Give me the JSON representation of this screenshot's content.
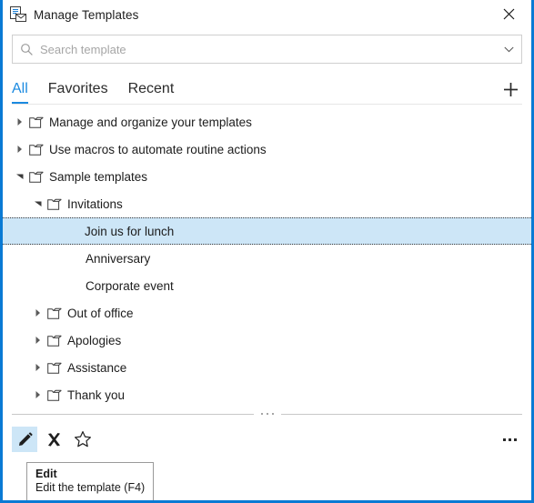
{
  "window": {
    "title": "Manage Templates",
    "title_icon": "template-envelope-icon",
    "close_icon": "close-icon",
    "accent_color": "#0a7ad4"
  },
  "search": {
    "placeholder": "Search template",
    "value": "",
    "icon": "search-icon",
    "dropdown_icon": "chevron-down-icon"
  },
  "tabs": {
    "items": [
      {
        "label": "All",
        "active": true
      },
      {
        "label": "Favorites",
        "active": false
      },
      {
        "label": "Recent",
        "active": false
      }
    ],
    "add_icon": "plus-icon",
    "active_color": "#1b8ae0"
  },
  "tree": {
    "nodes": [
      {
        "label": "Manage and organize your templates",
        "indent": 0,
        "twisty": "collapsed",
        "folder": true,
        "selected": false
      },
      {
        "label": "Use macros to automate routine actions",
        "indent": 0,
        "twisty": "collapsed",
        "folder": true,
        "selected": false
      },
      {
        "label": "Sample templates",
        "indent": 0,
        "twisty": "expanded",
        "folder": true,
        "selected": false
      },
      {
        "label": "Invitations",
        "indent": 1,
        "twisty": "expanded",
        "folder": true,
        "selected": false
      },
      {
        "label": "Join us for lunch",
        "indent": 2,
        "twisty": "none",
        "folder": false,
        "selected": true
      },
      {
        "label": "Anniversary",
        "indent": 2,
        "twisty": "none",
        "folder": false,
        "selected": false
      },
      {
        "label": "Corporate event",
        "indent": 2,
        "twisty": "none",
        "folder": false,
        "selected": false
      },
      {
        "label": "Out of office",
        "indent": 1,
        "twisty": "collapsed",
        "folder": true,
        "selected": false
      },
      {
        "label": "Apologies",
        "indent": 1,
        "twisty": "collapsed",
        "folder": true,
        "selected": false
      },
      {
        "label": "Assistance",
        "indent": 1,
        "twisty": "collapsed",
        "folder": true,
        "selected": false
      },
      {
        "label": "Thank you",
        "indent": 1,
        "twisty": "collapsed",
        "folder": true,
        "selected": false
      }
    ],
    "selected_bg": "#cde6f7"
  },
  "toolbar": {
    "buttons": [
      {
        "name": "edit-button",
        "icon": "pencil-icon",
        "hover": true
      },
      {
        "name": "delete-button",
        "icon": "x-icon",
        "hover": false
      },
      {
        "name": "favorite-button",
        "icon": "star-icon",
        "hover": false
      }
    ],
    "more_icon": "ellipsis-icon"
  },
  "tooltip": {
    "title": "Edit",
    "description": "Edit the template (F4)"
  }
}
